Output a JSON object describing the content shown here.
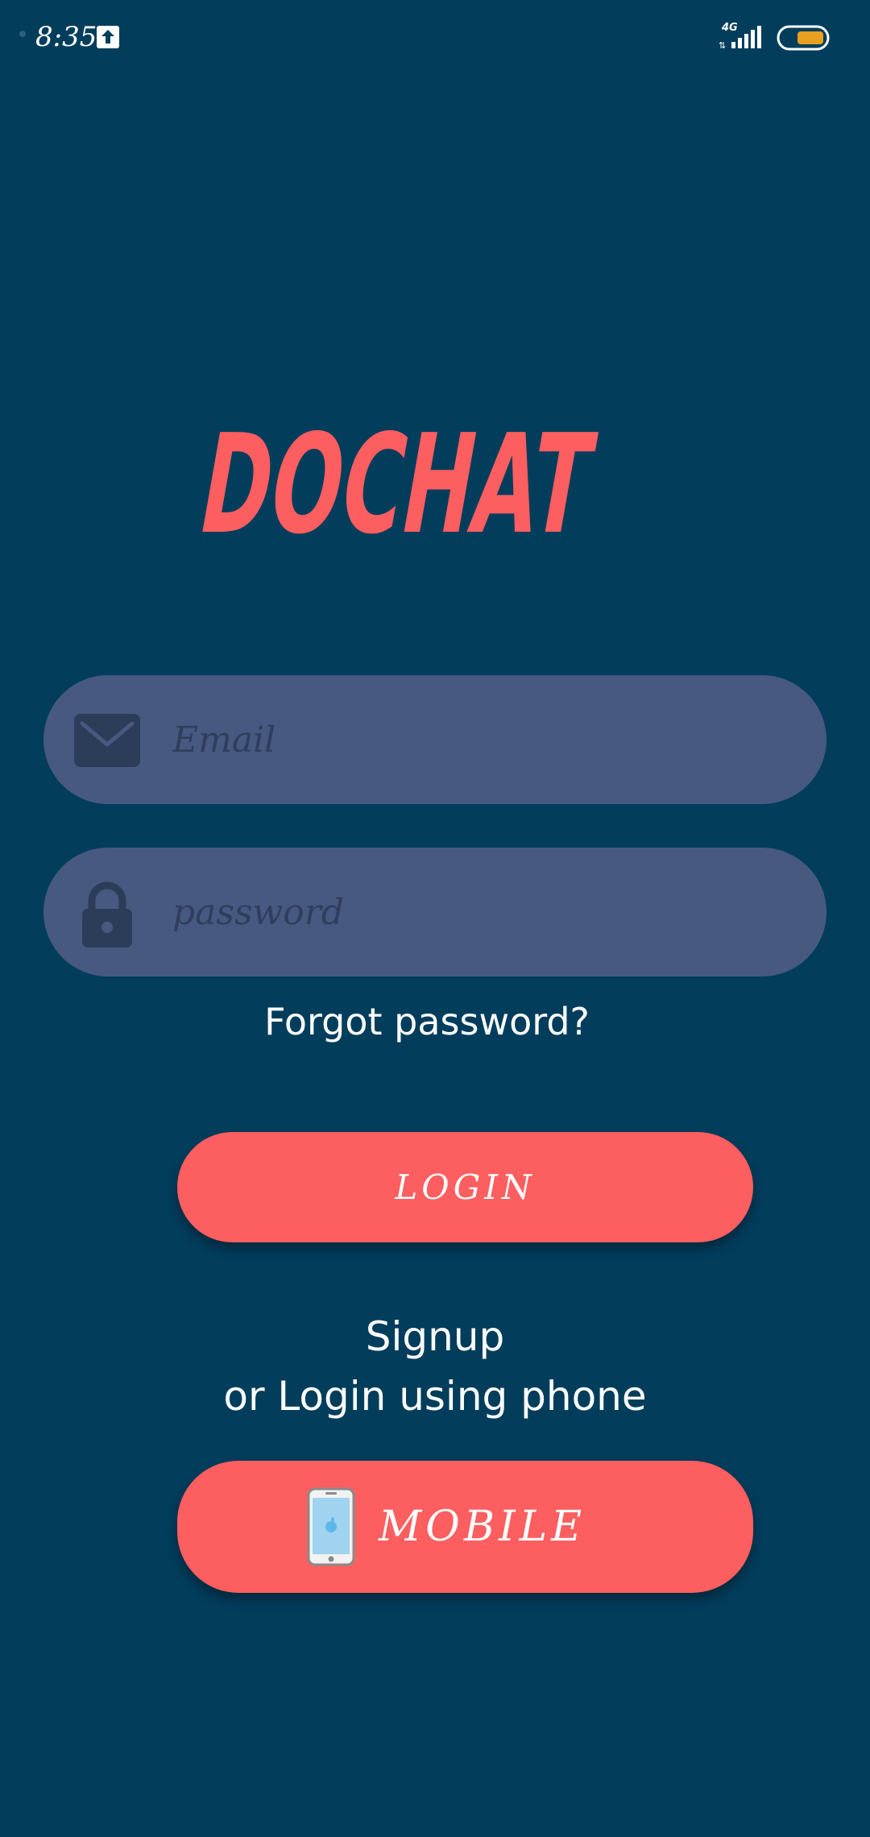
{
  "status_bar": {
    "time": "8:35",
    "network": "4G"
  },
  "logo": {
    "text": "DOCHAT"
  },
  "login_form": {
    "email_placeholder": "Email",
    "password_placeholder": "password",
    "forgot_password": "Forgot password?",
    "login_button": "LOGIN"
  },
  "alternate": {
    "signup": "Signup",
    "phone_text": "or Login using phone",
    "mobile_button": "MOBILE"
  },
  "colors": {
    "background": "#023d5c",
    "accent": "#fd5e5f",
    "field": "#475980"
  },
  "icons": {
    "email": "envelope-icon",
    "password": "lock-icon",
    "mobile": "smartphone-icon",
    "upload": "upload-icon",
    "signal": "signal-icon",
    "battery": "battery-icon"
  }
}
